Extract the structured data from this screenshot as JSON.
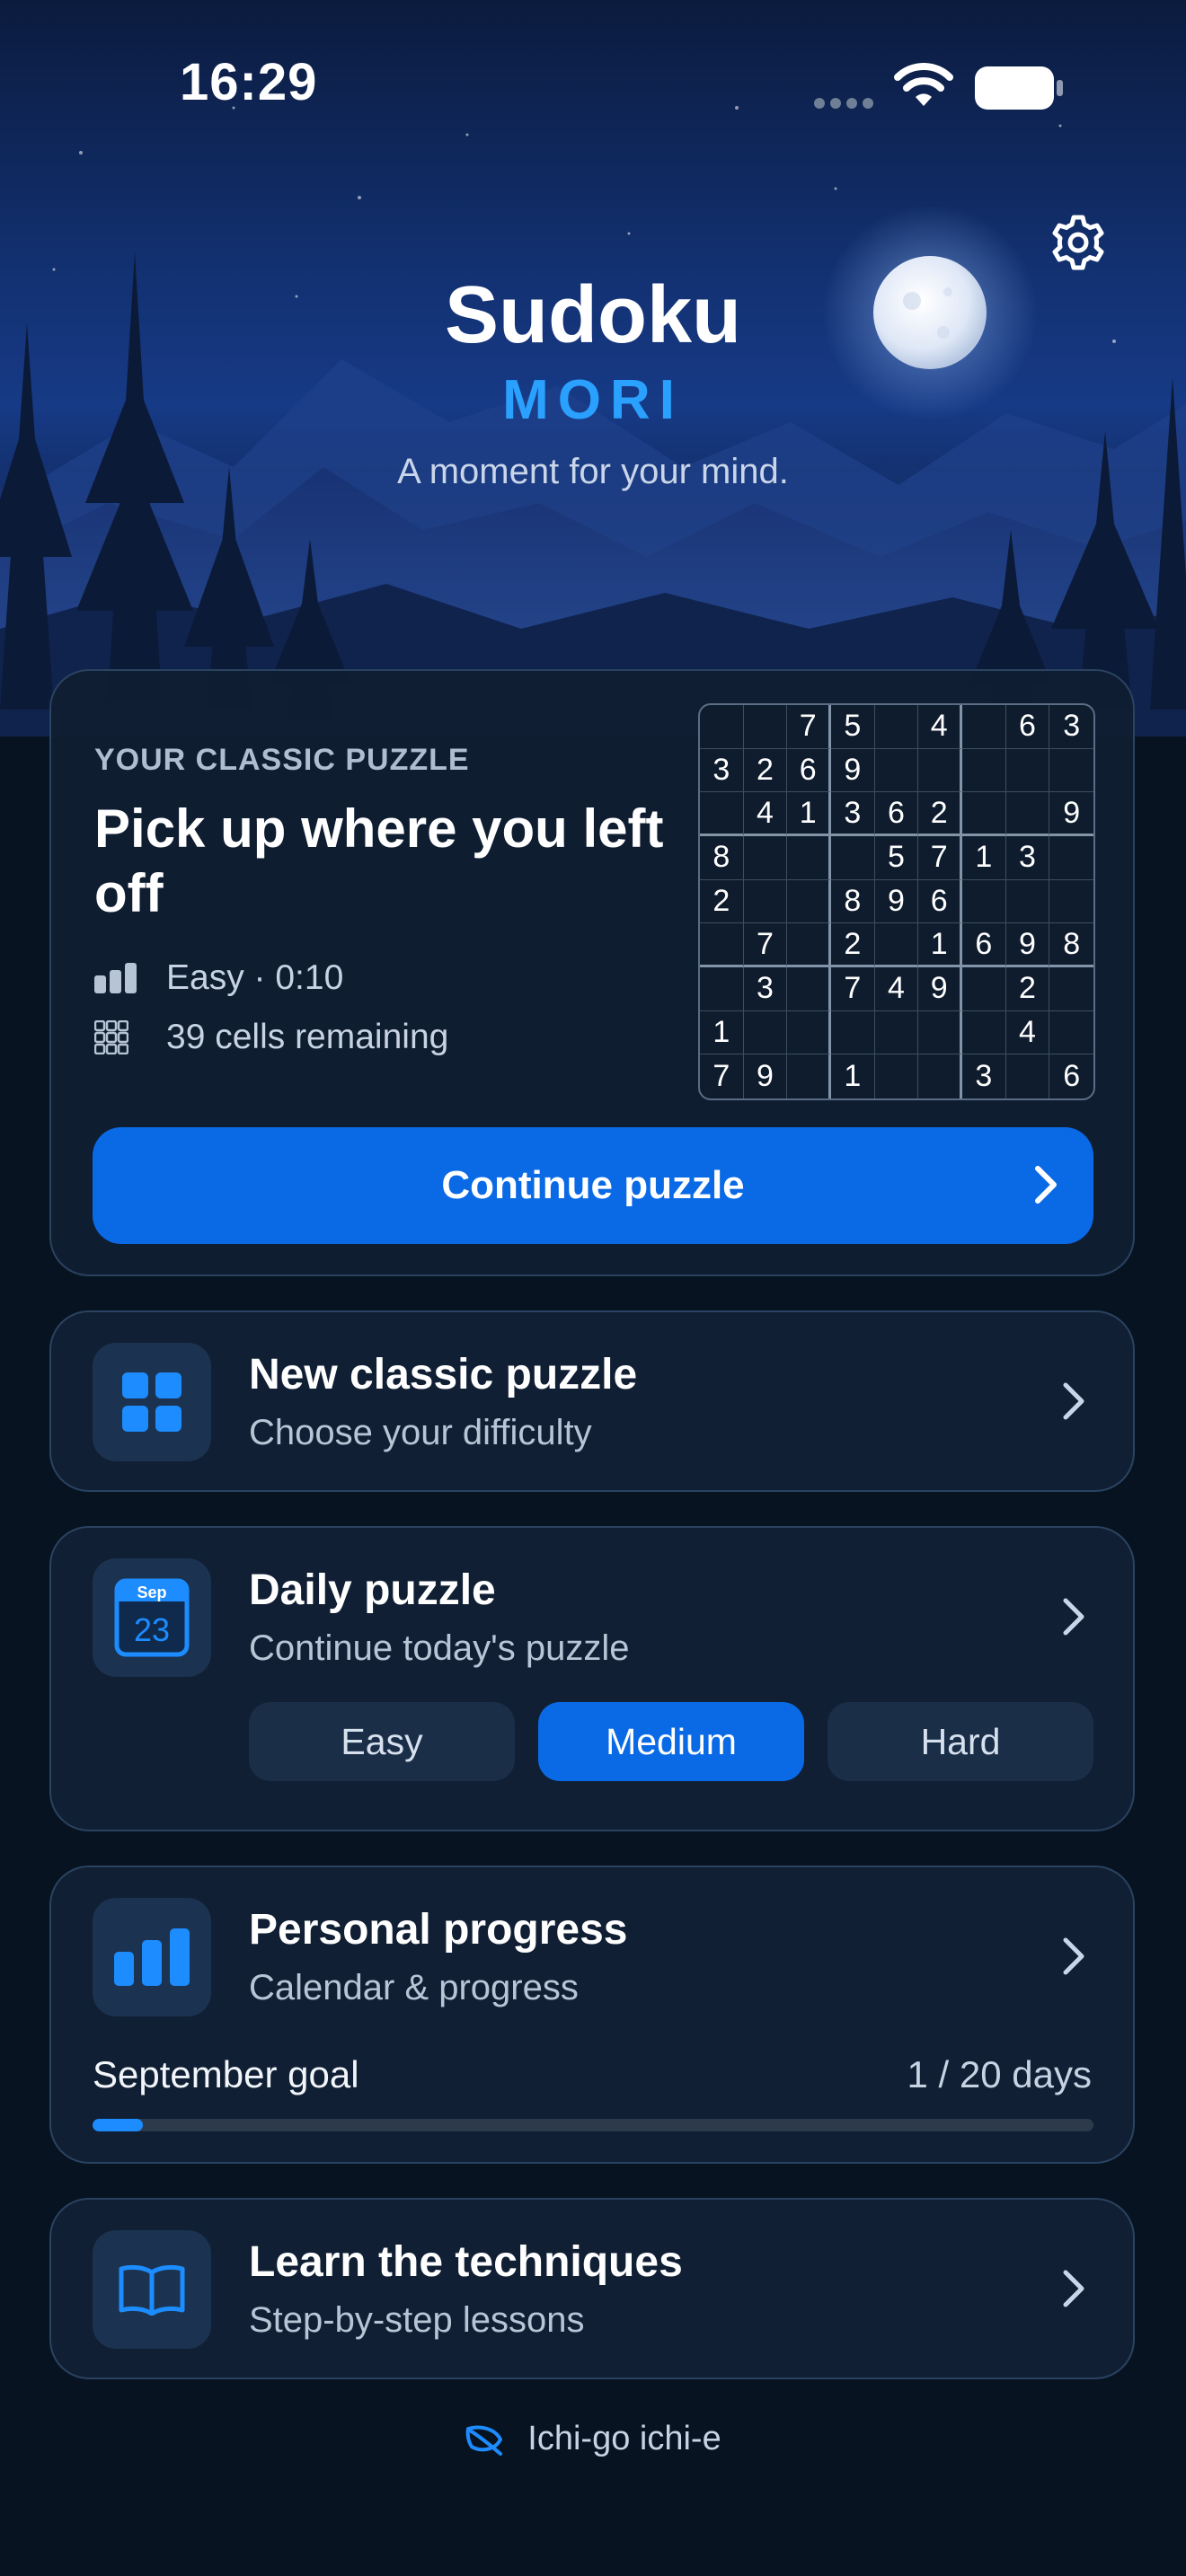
{
  "status_bar": {
    "time": "16:29"
  },
  "header": {
    "title": "Sudoku",
    "brand": "MORI",
    "tagline": "A moment for your mind."
  },
  "classic_card": {
    "eyebrow": "YOUR CLASSIC PUZZLE",
    "heading": "Pick up where you left off",
    "difficulty_time": "Easy · 0:10",
    "remaining": "39 cells remaining",
    "continue_label": "Continue puzzle",
    "board": [
      [
        "",
        "",
        "7",
        "5",
        "",
        "4",
        "",
        "6",
        "3"
      ],
      [
        "3",
        "2",
        "6",
        "9",
        "",
        "",
        "",
        "",
        ""
      ],
      [
        "",
        "4",
        "1",
        "3",
        "6",
        "2",
        "",
        "",
        "9"
      ],
      [
        "8",
        "",
        "",
        "",
        "5",
        "7",
        "1",
        "3",
        ""
      ],
      [
        "2",
        "",
        "",
        "8",
        "9",
        "6",
        "",
        "",
        ""
      ],
      [
        "",
        "7",
        "",
        "2",
        "",
        "1",
        "6",
        "9",
        "8"
      ],
      [
        "",
        "3",
        "",
        "7",
        "4",
        "9",
        "",
        "2",
        ""
      ],
      [
        "1",
        "",
        "",
        "",
        "",
        "",
        "",
        "4",
        ""
      ],
      [
        "7",
        "9",
        "",
        "1",
        "",
        "",
        "3",
        "",
        "6"
      ]
    ]
  },
  "new_classic": {
    "title": "New classic puzzle",
    "subtitle": "Choose your difficulty"
  },
  "daily": {
    "title": "Daily puzzle",
    "subtitle": "Continue today's puzzle",
    "calendar_month": "Sep",
    "calendar_day": "23",
    "difficulties": [
      "Easy",
      "Medium",
      "Hard"
    ],
    "selected": "Medium"
  },
  "progress": {
    "title": "Personal progress",
    "subtitle": "Calendar & progress",
    "goal_label": "September goal",
    "goal_value": "1 / 20 days",
    "goal_fraction": 0.05
  },
  "learn": {
    "title": "Learn the techniques",
    "subtitle": "Step-by-step lessons"
  },
  "footer": {
    "text": "Ichi-go ichi-e"
  },
  "colors": {
    "accent": "#0a6ae6",
    "brand": "#2aa0ff",
    "background": "#081321"
  }
}
